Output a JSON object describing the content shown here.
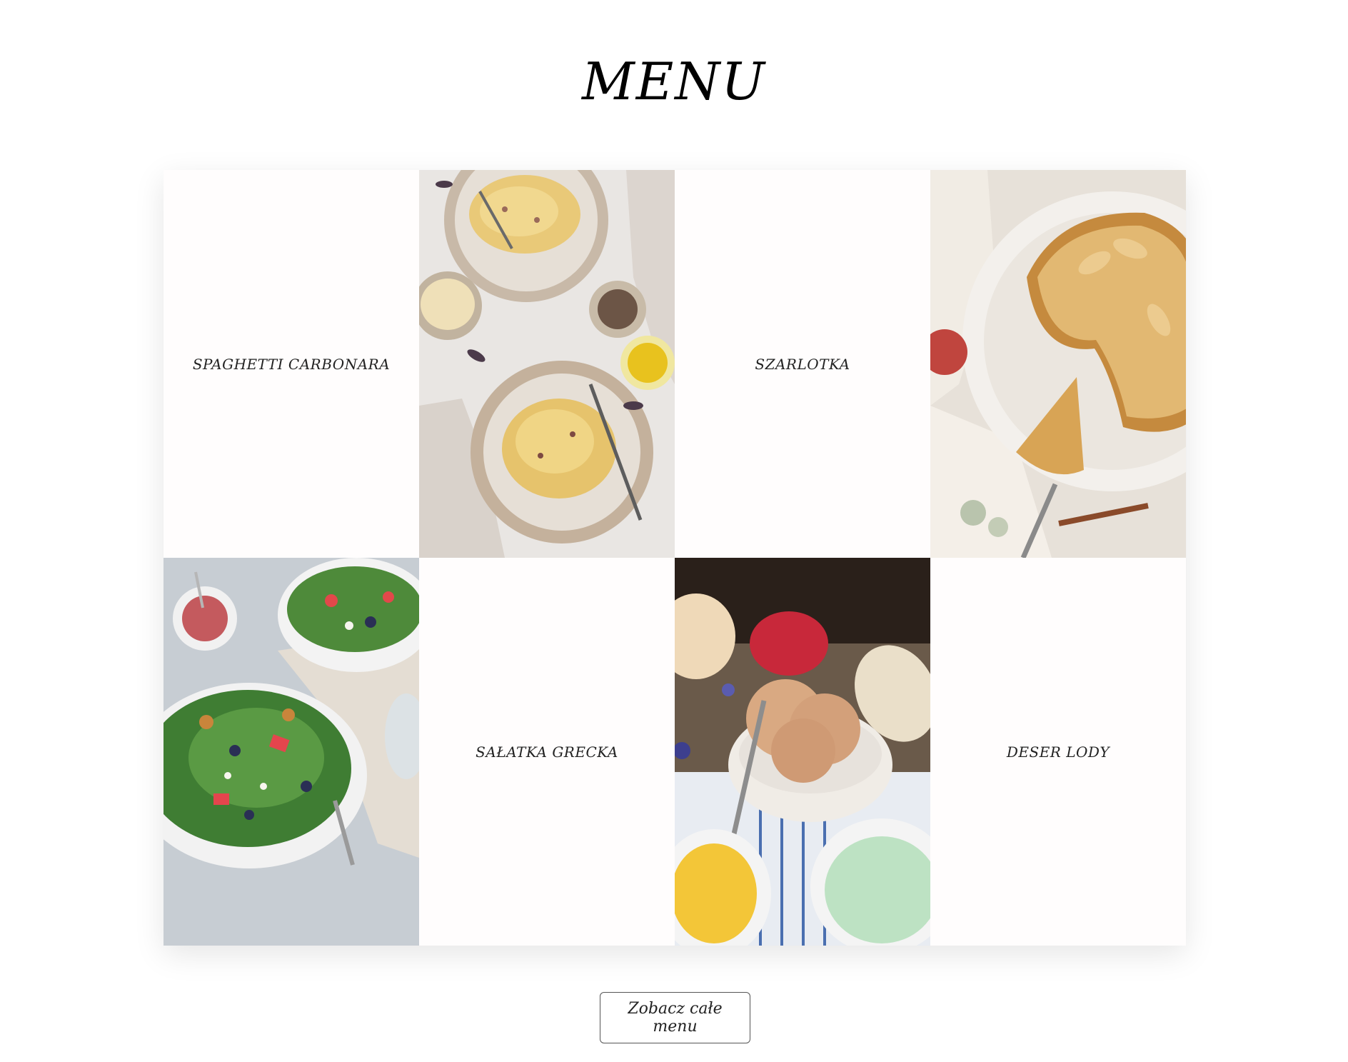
{
  "header": {
    "title": "MENU"
  },
  "menu": {
    "items": [
      {
        "name": "SPAGHETTI CARBONARA",
        "photo": "pasta-carbonara"
      },
      {
        "name": "SZARLOTKA",
        "photo": "apple-pie"
      },
      {
        "name": "SAŁATKA GRECKA",
        "photo": "greek-salad"
      },
      {
        "name": "DESER LODY",
        "photo": "ice-cream"
      }
    ]
  },
  "footer": {
    "button_label": "Zobacz całe menu"
  },
  "colors": {
    "background": "#ffffff",
    "text": "#111111",
    "button_border": "#555555"
  }
}
